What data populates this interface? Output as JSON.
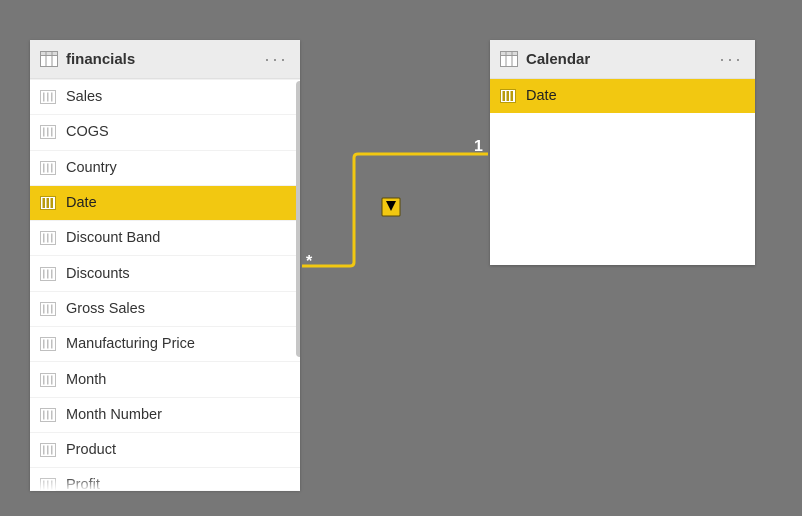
{
  "tables": {
    "financials": {
      "title": "financials",
      "fields": [
        "Sales",
        "COGS",
        "Country",
        "Date",
        "Discount Band",
        "Discounts",
        "Gross Sales",
        "Manufacturing Price",
        "Month",
        "Month Number",
        "Product",
        "Profit"
      ],
      "selected_field": "Date"
    },
    "calendar": {
      "title": "Calendar",
      "fields": [
        "Date"
      ],
      "selected_field": "Date"
    }
  },
  "relationship": {
    "from_table": "financials",
    "from_field": "Date",
    "from_cardinality": "*",
    "to_table": "Calendar",
    "to_field": "Date",
    "to_cardinality": "1",
    "direction": "single"
  }
}
